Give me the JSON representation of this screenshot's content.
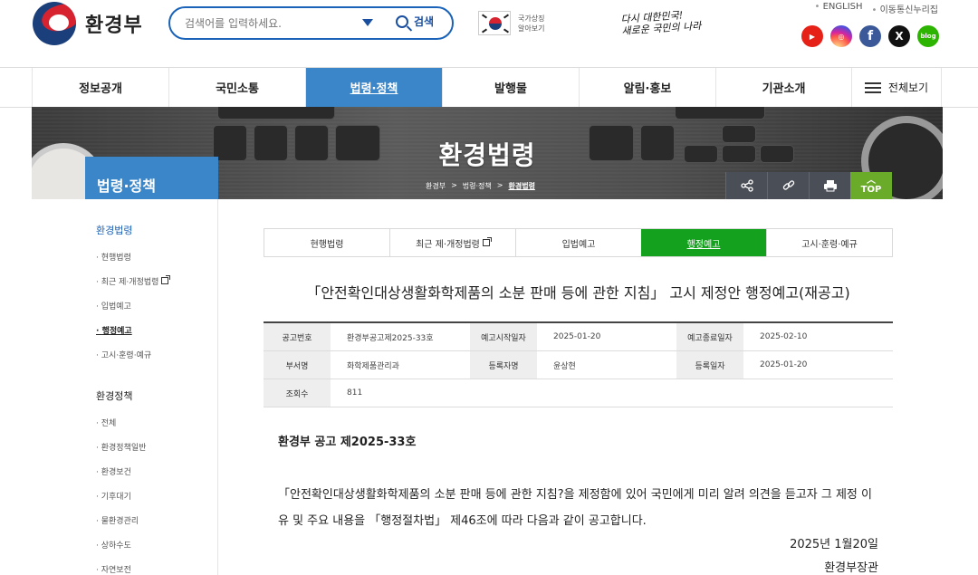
{
  "header": {
    "logo_text": "환경부",
    "search": {
      "placeholder": "검색어를 입력하세요.",
      "button_label": "검색"
    },
    "national_symbol": {
      "line1": "국가상징",
      "line2": "알아보기"
    },
    "slogan": {
      "line1": "다시 대한민국!",
      "line2": "새로운 국민의 나라"
    },
    "top_links": [
      "ENGLISH",
      "이동통신누리집"
    ],
    "sns": [
      {
        "name": "youtube",
        "label": "▶",
        "color": "#e62117"
      },
      {
        "name": "instagram",
        "label": "◎",
        "color": "#d6249f"
      },
      {
        "name": "facebook",
        "label": "f",
        "color": "#3b5998"
      },
      {
        "name": "x",
        "label": "X",
        "color": "#111111"
      },
      {
        "name": "blog",
        "label": "blog",
        "color": "#2db400"
      }
    ]
  },
  "gnb": {
    "items": [
      "정보공개",
      "국민소통",
      "법령·정책",
      "발행물",
      "알림·홍보",
      "기관소개"
    ],
    "active_index": 2,
    "all_menu": "전체보기"
  },
  "banner": {
    "title": "환경법령",
    "breadcrumb": [
      "환경부",
      "법령·정책",
      "환경법령"
    ],
    "top_label": "TOP"
  },
  "lnb": {
    "title": "법령·정책",
    "group1_title": "환경법령",
    "group1": [
      "현행법령",
      "최근 제·개정법령",
      "입법예고",
      "행정예고",
      "고시·훈령·예규"
    ],
    "group1_current": 3,
    "group2_title": "환경정책",
    "group2": [
      "전체",
      "환경정책일반",
      "환경보건",
      "기후대기",
      "물환경관리",
      "상하수도",
      "자연보전"
    ]
  },
  "tabs": {
    "items": [
      "현행법령",
      "최근 제·개정법령",
      "입법예고",
      "행정예고",
      "고시·훈령·예규"
    ],
    "active_index": 3
  },
  "document": {
    "title": "「안전확인대상생활화학제품의 소분 판매 등에 관한 지침」 고시 제정안 행정예고(재공고)",
    "info": {
      "announcement_no_label": "공고번호",
      "announcement_no": "환경부공고제2025-33호",
      "start_label": "예고시작일자",
      "start_date": "2025-01-20",
      "end_label": "예고종료일자",
      "end_date": "2025-02-10",
      "dept_label": "부서명",
      "dept": "화학제품관리과",
      "registrant_label": "등록자명",
      "registrant": "윤상현",
      "reg_date_label": "등록일자",
      "reg_date": "2025-01-20",
      "views_label": "조회수",
      "views": "811"
    },
    "notice_heading": "환경부 공고 제2025-33호",
    "notice_body": "「안전확인대상생활화학제품의 소분 판매 등에 관한 지침?을 제정함에 있어 국민에게 미리 알려 의견을 듣고자 그 제정 이유 및 주요 내용을 「행정절차법」 제46조에 따라 다음과 같이 공고합니다.",
    "notice_date": "2025년 1월20일",
    "notice_signer": "환경부장관"
  }
}
